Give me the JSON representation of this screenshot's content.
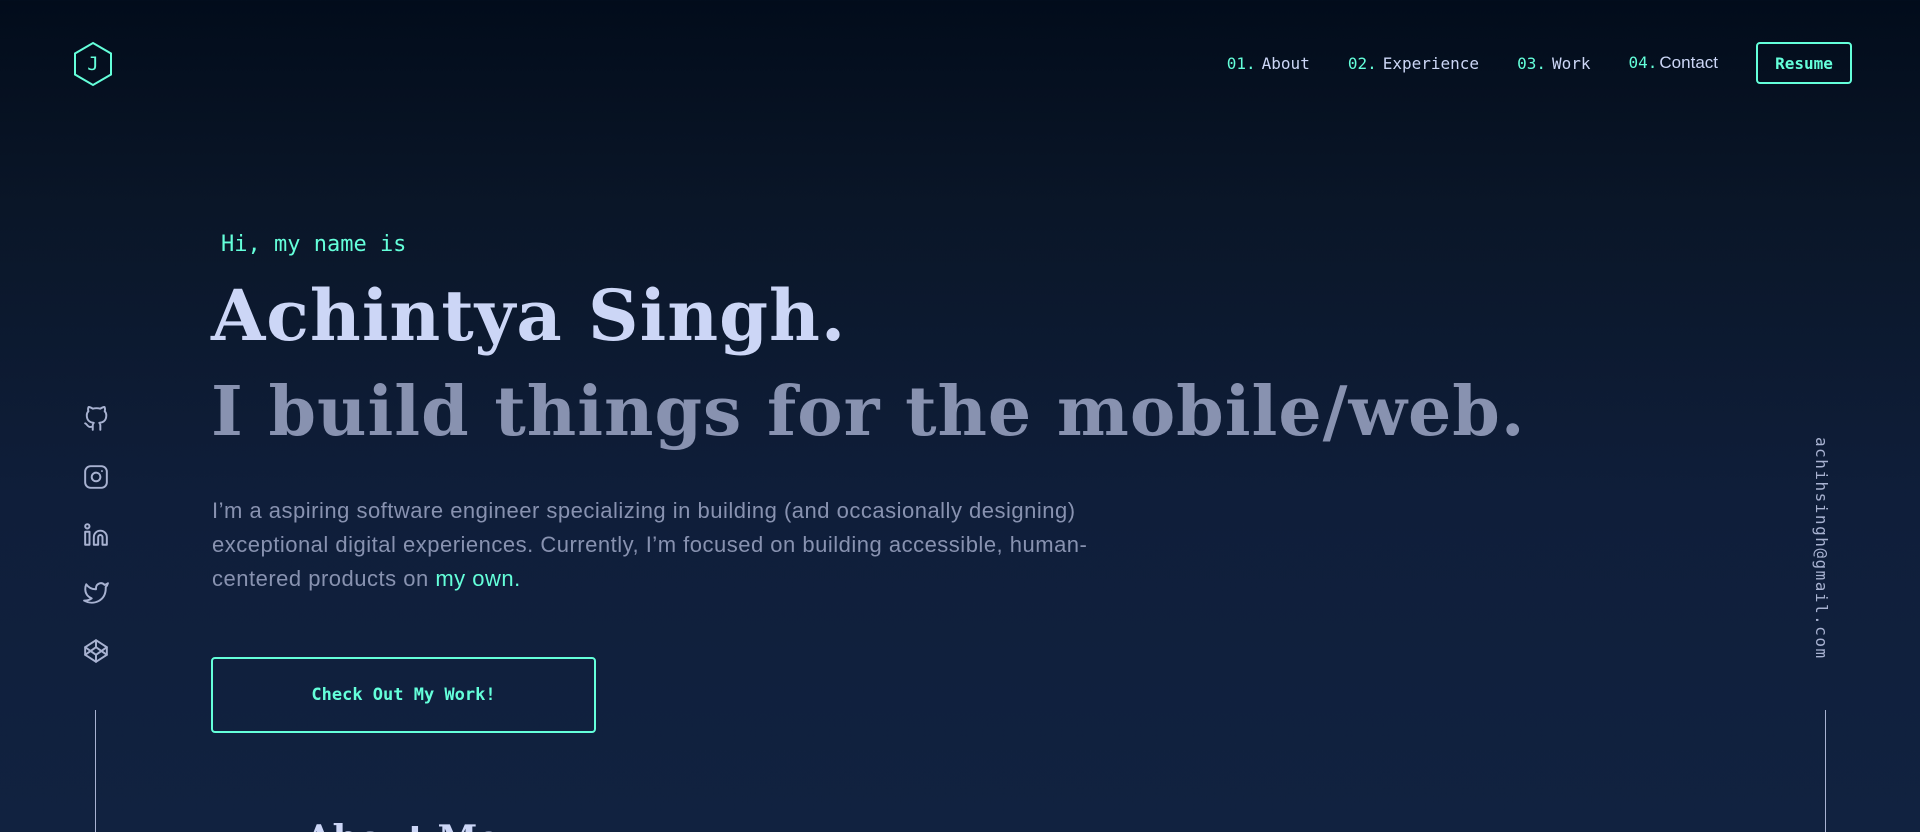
{
  "header": {
    "logo_letter": "J",
    "nav": [
      {
        "num": "01.",
        "label": "About"
      },
      {
        "num": "02.",
        "label": "Experience"
      },
      {
        "num": "03.",
        "label": "Work"
      },
      {
        "num": "04.",
        "label": "Contact"
      }
    ],
    "resume_label": "Resume"
  },
  "social": {
    "icons": [
      "github-icon",
      "instagram-icon",
      "linkedin-icon",
      "twitter-icon",
      "codepen-icon"
    ]
  },
  "email": "achihsingh@gmail.com",
  "hero": {
    "intro": "Hi, my name is",
    "name": "Achintya Singh.",
    "tagline": "I build things for the mobile/web.",
    "description": "I’m a aspiring software engineer specializing in building (and occasionally designing) exceptional digital experiences. Currently, I’m focused on building accessible, human-centered products on ",
    "description_link": "my own.",
    "cta_label": "Check Out My Work!"
  },
  "next_section": {
    "heading": "About Me"
  },
  "colors": {
    "accent": "#64ffda",
    "background": "#0a192f",
    "heading": "#ccd6f6",
    "muted": "#8892b0"
  }
}
